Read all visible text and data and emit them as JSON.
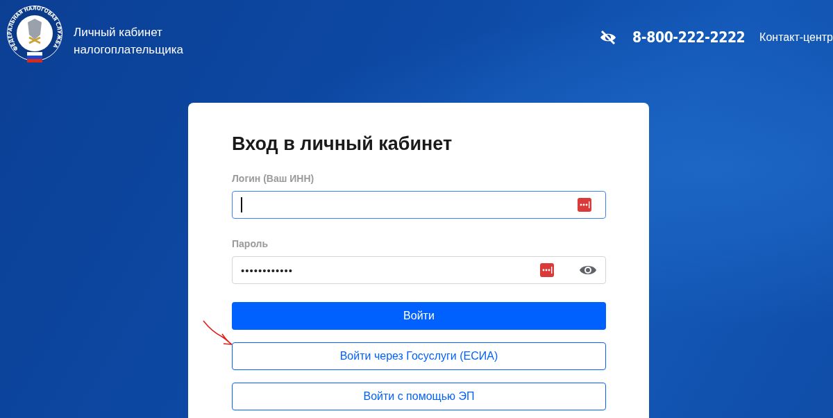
{
  "header": {
    "logo_ring_text": "ФЕДЕРАЛЬНАЯ НАЛОГОВАЯ СЛУЖБА",
    "title_lines": [
      "Личный кабинет",
      "налогоплательщика"
    ],
    "phone": "8-800-222-2222",
    "contact_label": "Контакт-центр"
  },
  "form": {
    "title": "Вход в личный кабинет",
    "fields": [
      {
        "label": "Логин (Ваш ИНН)",
        "focused": true,
        "kind": "text"
      },
      {
        "label": "Пароль",
        "value": "••••••••••••",
        "focused": false,
        "kind": "password"
      }
    ],
    "buttons": [
      {
        "label": "Войти",
        "kind": "primary",
        "annotated": false
      },
      {
        "label": "Войти через Госуслуги (ЕСИА)",
        "kind": "outline",
        "annotated": true
      },
      {
        "label": "Войти с помощью ЭП",
        "kind": "outline",
        "annotated": false
      }
    ]
  }
}
